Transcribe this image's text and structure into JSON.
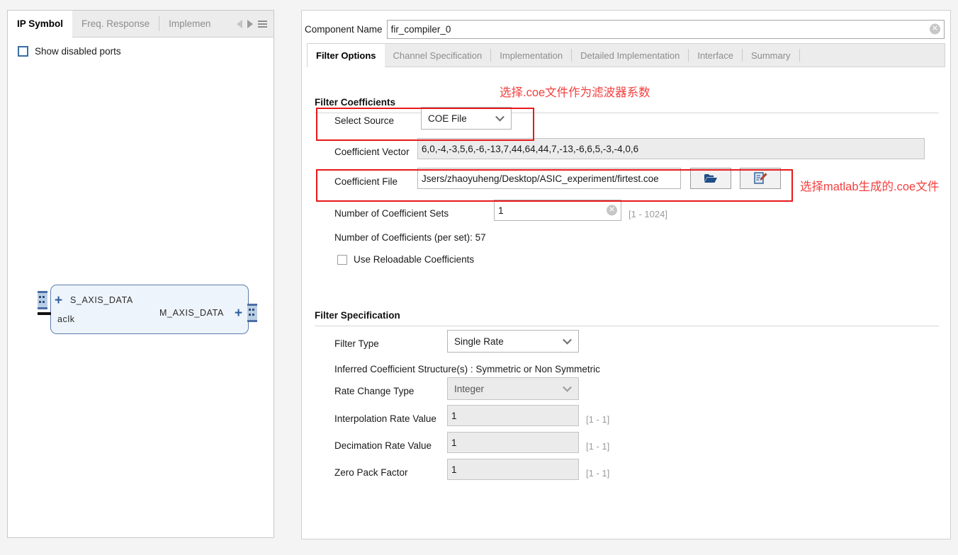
{
  "left_panel": {
    "tabs": [
      {
        "label": "IP Symbol",
        "active": true
      },
      {
        "label": "Freq. Response",
        "active": false
      },
      {
        "label": "Implemen",
        "active": false
      }
    ],
    "nav": {
      "prev_icon": "triangle-left-icon",
      "next_icon": "triangle-right-icon",
      "menu_icon": "hamburger-menu-icon"
    },
    "show_disabled_ports": {
      "label": "Show disabled ports",
      "checked": false
    },
    "ip_symbol": {
      "slave_port": "S_AXIS_DATA",
      "master_port": "M_AXIS_DATA",
      "clock_port": "aclk"
    }
  },
  "component_name": {
    "label": "Component Name",
    "value": "fir_compiler_0",
    "clear_icon": "clear-circle-icon"
  },
  "main_tabs": [
    {
      "label": "Filter Options",
      "active": true
    },
    {
      "label": "Channel Specification",
      "active": false
    },
    {
      "label": "Implementation",
      "active": false
    },
    {
      "label": "Detailed Implementation",
      "active": false
    },
    {
      "label": "Interface",
      "active": false
    },
    {
      "label": "Summary",
      "active": false
    }
  ],
  "filter_coefficients": {
    "section_title": "Filter Coefficients",
    "select_source": {
      "label": "Select Source",
      "value": "COE File"
    },
    "coefficient_vector": {
      "label": "Coefficient Vector",
      "value": "6,0,-4,-3,5,6,-6,-13,7,44,64,44,7,-13,-6,6,5,-3,-4,0,6"
    },
    "coefficient_file": {
      "label": "Coefficient File",
      "value": "Jsers/zhaoyuheng/Desktop/ASIC_experiment/firtest.coe",
      "browse_icon": "folder-open-icon",
      "edit_icon": "edit-document-icon"
    },
    "number_of_sets": {
      "label": "Number of Coefficient Sets",
      "value": "1",
      "range": "[1 - 1024]",
      "clear_icon": "clear-circle-icon"
    },
    "coefficients_per_set": "Number of Coefficients (per set): 57",
    "use_reloadable": {
      "label": "Use Reloadable Coefficients",
      "checked": false
    }
  },
  "filter_specification": {
    "section_title": "Filter Specification",
    "filter_type": {
      "label": "Filter Type",
      "value": "Single Rate"
    },
    "inferred_structure": "Inferred Coefficient Structure(s) : Symmetric or Non Symmetric",
    "rate_change_type": {
      "label": "Rate Change Type",
      "value": "Integer"
    },
    "interpolation_rate": {
      "label": "Interpolation Rate Value",
      "value": "1",
      "range": "[1 - 1]"
    },
    "decimation_rate": {
      "label": "Decimation Rate Value",
      "value": "1",
      "range": "[1 - 1]"
    },
    "zero_pack_factor": {
      "label": "Zero Pack Factor",
      "value": "1",
      "range": "[1 - 1]"
    }
  },
  "annotations": {
    "top": "选择.coe文件作为滤波器系数",
    "right": "选择matlab生成的.coe文件",
    "color": "#f2403f"
  }
}
